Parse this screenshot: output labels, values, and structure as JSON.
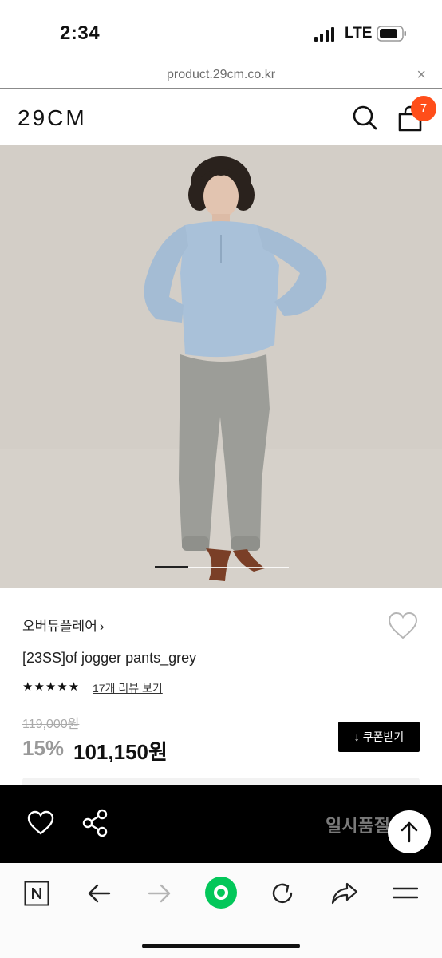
{
  "status_bar": {
    "time": "2:34",
    "network": "LTE"
  },
  "browser": {
    "url": "product.29cm.co.kr",
    "close_label": "×"
  },
  "header": {
    "logo": "29CM",
    "cart_count": "7"
  },
  "gallery": {
    "slide_index": 1,
    "slide_count": 4
  },
  "product": {
    "brand": "오버듀플레어",
    "brand_chevron": "›",
    "name": "[23SS]of jogger pants_grey",
    "rating_stars": "★★★★★",
    "rating": 5,
    "reviews_label": "17개 리뷰 보기",
    "original_price": "119,000원",
    "discount": "15%",
    "price": "101,150원",
    "coupon_label": "쿠폰받기",
    "coupon_icon": "↓"
  },
  "action_bar": {
    "status_label": "일시품절"
  },
  "colors": {
    "accent": "#ff4e1a",
    "green": "#03c75a",
    "black": "#000000"
  },
  "icons": [
    "search-icon",
    "cart-icon",
    "heart-icon",
    "share-icon",
    "arrow-up-icon",
    "naver-icon",
    "back-icon",
    "forward-icon",
    "green-dot-icon",
    "reload-icon",
    "share-arrow-icon",
    "menu-icon"
  ]
}
